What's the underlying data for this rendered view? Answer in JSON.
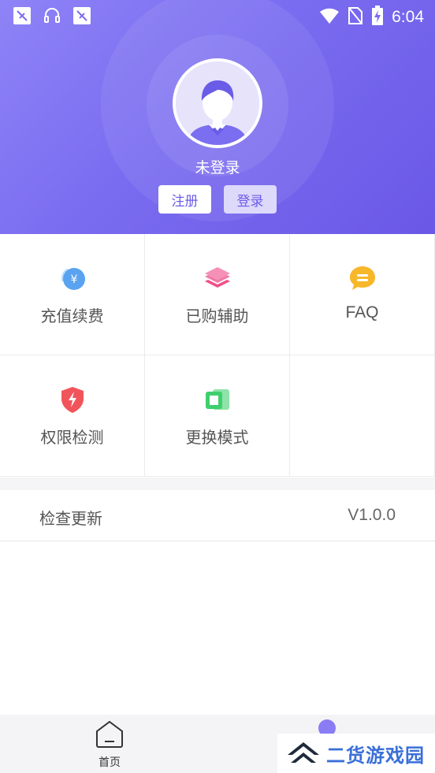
{
  "status_bar": {
    "time": "6:04",
    "left_icons": [
      "notification-icon",
      "headset-icon",
      "notification-icon"
    ],
    "right_icons": [
      "wifi-icon",
      "no-sim-icon",
      "battery-charging-icon"
    ]
  },
  "profile": {
    "username": "未登录",
    "register_label": "注册",
    "login_label": "登录"
  },
  "grid": {
    "items": [
      {
        "label": "充值续费",
        "icon": "recharge-icon",
        "color": "#5aa3f0"
      },
      {
        "label": "已购辅助",
        "icon": "layers-icon",
        "color": "#f0508a"
      },
      {
        "label": "FAQ",
        "icon": "faq-chat-icon",
        "color": "#f7b72a"
      },
      {
        "label": "权限检测",
        "icon": "shield-icon",
        "color": "#f2545b"
      },
      {
        "label": "更换模式",
        "icon": "switch-mode-icon",
        "color": "#3fcf6e"
      }
    ]
  },
  "update": {
    "label": "检查更新",
    "version": "V1.0.0"
  },
  "bottom_nav": {
    "home_label": "首页"
  },
  "watermark": {
    "text": "二货游戏园"
  },
  "colors": {
    "accent": "#7a6cf0",
    "header_gradient_start": "#8f83f7",
    "header_gradient_end": "#6a58e6"
  }
}
